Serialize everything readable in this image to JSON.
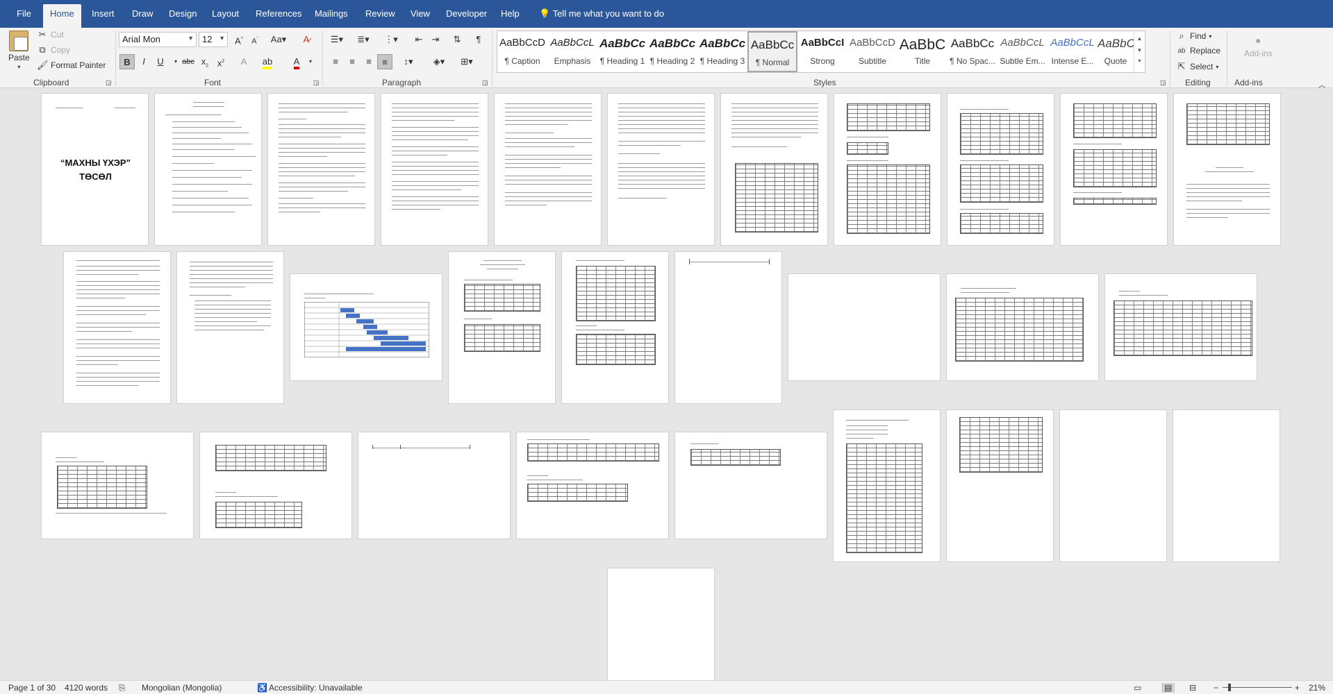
{
  "tabs": {
    "file": "File",
    "home": "Home",
    "insert": "Insert",
    "draw": "Draw",
    "design": "Design",
    "layout": "Layout",
    "references": "References",
    "mailings": "Mailings",
    "review": "Review",
    "view": "View",
    "developer": "Developer",
    "help": "Help",
    "tell_me": "Tell me what you want to do"
  },
  "clipboard": {
    "paste": "Paste",
    "cut": "Cut",
    "copy": "Copy",
    "format_painter": "Format Painter",
    "group": "Clipboard"
  },
  "font": {
    "name": "Arial Mon",
    "size": "12",
    "group": "Font"
  },
  "paragraph": {
    "group": "Paragraph"
  },
  "styles": {
    "group": "Styles",
    "items": [
      {
        "preview": "AaBbCcD",
        "name": "¶ Caption"
      },
      {
        "preview": "AaBbCcL",
        "name": "Emphasis"
      },
      {
        "preview": "AaBbCc",
        "name": "¶ Heading 1"
      },
      {
        "preview": "AaBbCc",
        "name": "¶ Heading 2"
      },
      {
        "preview": "AaBbCc",
        "name": "¶ Heading 3"
      },
      {
        "preview": "AaBbCc",
        "name": "¶ Normal"
      },
      {
        "preview": "AaBbCcI",
        "name": "Strong"
      },
      {
        "preview": "AaBbCcD",
        "name": "Subtitle"
      },
      {
        "preview": "AaBbC",
        "name": "Title"
      },
      {
        "preview": "AaBbCc",
        "name": "¶ No Spac..."
      },
      {
        "preview": "AaBbCcL",
        "name": "Subtle Em..."
      },
      {
        "preview": "AaBbCcL",
        "name": "Intense E..."
      },
      {
        "preview": "AaBbCc",
        "name": "Quote"
      }
    ]
  },
  "editing": {
    "find": "Find",
    "replace": "Replace",
    "select": "Select",
    "group": "Editing"
  },
  "addins": {
    "label": "Add-ins",
    "group": "Add-ins"
  },
  "document": {
    "cover_title_line1": "“МАХНЫ ҮХЭР”",
    "cover_title_line2": "ТӨСӨЛ"
  },
  "status": {
    "page": "Page 1 of 30",
    "words": "4120 words",
    "language": "Mongolian (Mongolia)",
    "accessibility": "Accessibility: Unavailable",
    "zoom": "21%"
  },
  "colors": {
    "titlebar": "#2b579a",
    "highlight_yellow": "#ffff00",
    "font_red": "#e00000",
    "gantt_blue": "#4472c4"
  }
}
